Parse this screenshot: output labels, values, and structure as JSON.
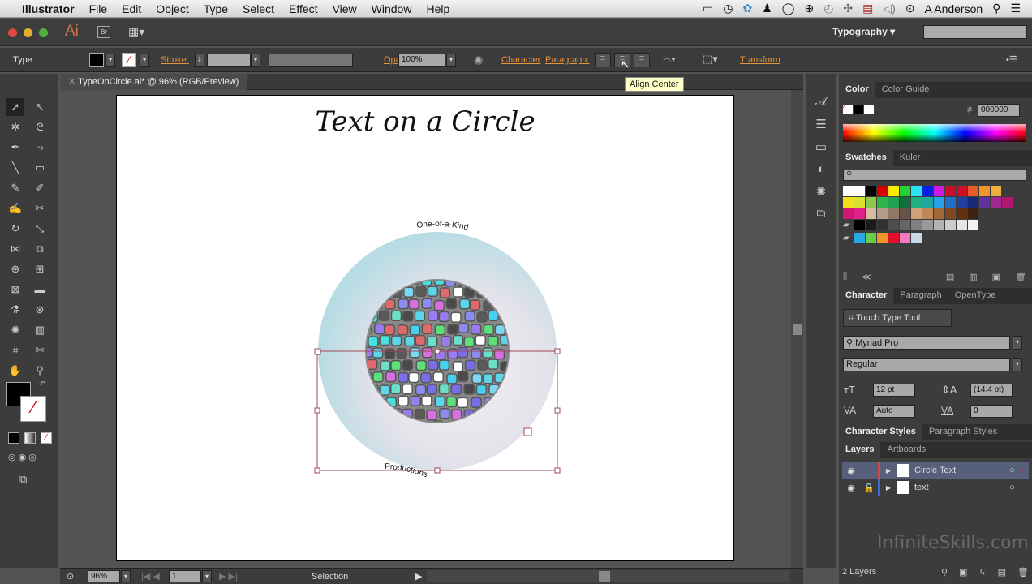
{
  "menubar": {
    "app": "Illustrator",
    "items": [
      "File",
      "Edit",
      "Object",
      "Type",
      "Select",
      "Effect",
      "View",
      "Window",
      "Help"
    ],
    "user": "A Anderson"
  },
  "appbar": {
    "logo": "Ai",
    "bridge": "Br",
    "workspace": "Typography",
    "search_placeholder": ""
  },
  "control": {
    "mode": "Type",
    "stroke_label": "Stroke:",
    "opacity_label": "Opacity:",
    "opacity_value": "100%",
    "character": "Character",
    "paragraph": "Paragraph:",
    "transform": "Transform"
  },
  "tooltip": "Align Center",
  "document": {
    "tab": "TypeOnCircle.ai* @ 96% (RGB/Preview)",
    "title": "Text on a Circle",
    "path_text_top": "One-of-a-Kind",
    "path_text_bottom": "Productions"
  },
  "mosaic_colors": [
    "#5ad6e8",
    "#7a6ee8",
    "#45e0e0",
    "#5a5a5a",
    "#6ae0c8",
    "#9a7cf0",
    "#ffffff",
    "#5ce07a",
    "#d86ee0",
    "#e06a6a",
    "#7ad8f0",
    "#4a4a4a",
    "#48d0f0",
    "#8c8cf0"
  ],
  "color_panel": {
    "tabs": [
      "Color",
      "Color Guide"
    ],
    "hex": "000000"
  },
  "swatches_panel": {
    "tabs": [
      "Swatches",
      "Kuler"
    ],
    "rows": [
      [
        "#ffffff",
        "#ffffff",
        "#000000",
        "#d40000",
        "#ffeb00",
        "#22d03a",
        "#29e4f4",
        "#0022e0",
        "#cc1ae0",
        "#c8102e",
        "#d0102a",
        "#e85a2a",
        "#f0962a",
        "#f0b040"
      ],
      [
        "#f4e01a",
        "#d8e030",
        "#8cc84a",
        "#2ab44a",
        "#20a050",
        "#107040",
        "#20b080",
        "#20a8a0",
        "#28a0e8",
        "#2070c8",
        "#2040a0",
        "#182878",
        "#6030a0",
        "#a02890",
        "#b01870"
      ],
      [
        "#d01870",
        "#e0208a",
        "#d8bca0",
        "#b09c88",
        "#907868",
        "#6a5448",
        "#d0a078",
        "#c08858",
        "#a06838",
        "#804820",
        "#603010",
        "#402010"
      ],
      [
        "#000000",
        "#1a1a1a",
        "#333333",
        "#4d4d4d",
        "#666666",
        "#808080",
        "#999999",
        "#b3b3b3",
        "#cccccc",
        "#e6e6e6",
        "#f2f2f2"
      ],
      [
        "#29a8e8",
        "#6acc4a",
        "#f0962a",
        "#e0102a",
        "#f07ac0",
        "#c8d8e8"
      ]
    ]
  },
  "character_panel": {
    "tabs": [
      "Character",
      "Paragraph",
      "OpenType"
    ],
    "touch_type": "Touch Type Tool",
    "font": "Myriad Pro",
    "style": "Regular",
    "size": "12 pt",
    "leading": "(14.4 pt)",
    "kerning": "Auto",
    "tracking": "0"
  },
  "styles_tabs": [
    "Character Styles",
    "Paragraph Styles"
  ],
  "layers_panel": {
    "tabs": [
      "Layers",
      "Artboards"
    ],
    "layers": [
      {
        "name": "Circle Text",
        "color": "#d04848"
      },
      {
        "name": "text",
        "color": "#3a6ed8"
      }
    ],
    "count": "2 Layers"
  },
  "status": {
    "zoom": "96%",
    "artboard": "1",
    "tool": "Selection"
  },
  "watermark": "InfiniteSkills.com"
}
